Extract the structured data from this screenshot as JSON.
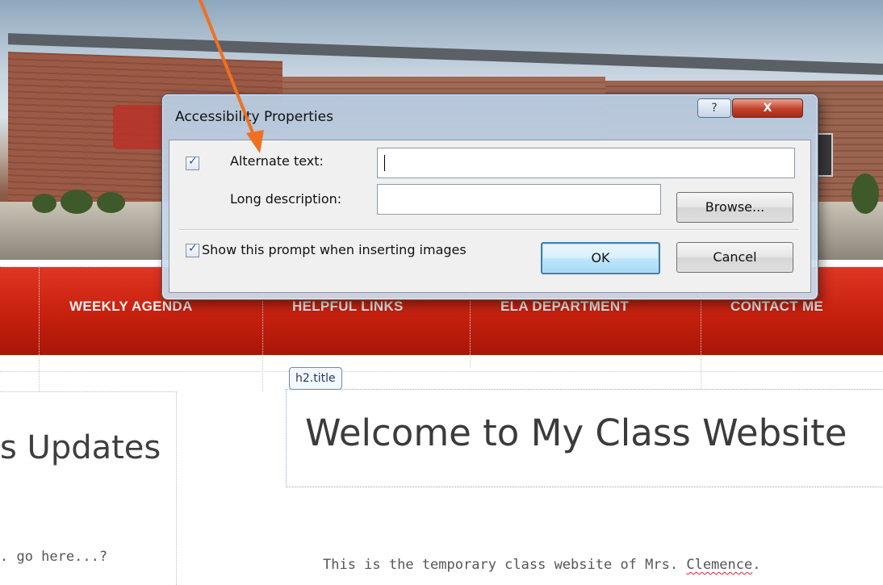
{
  "navigation": {
    "items": [
      {
        "label": "WEEKLY AGENDA"
      },
      {
        "label": "HELPFUL LINKS"
      },
      {
        "label": "ELA DEPARTMENT"
      },
      {
        "label": "CONTACT ME"
      }
    ]
  },
  "editor": {
    "element_tag": "h2.title"
  },
  "page": {
    "title": "Welcome to My Class Website",
    "sidebar_heading": "s Updates",
    "sidebar_text": ". go here...?",
    "intro_prefix": "This is the temporary class website of Mrs. ",
    "intro_name": "Clemence",
    "intro_suffix": "."
  },
  "dialog": {
    "title": "Accessibility Properties",
    "help_label": "?",
    "close_label": "X",
    "alt_text": {
      "label": "Alternate text:",
      "value": "",
      "checked": true
    },
    "long_description": {
      "label": "Long description:",
      "value": ""
    },
    "browse_label": "Browse...",
    "show_prompt": {
      "label": "Show this prompt when inserting images",
      "checked": true
    },
    "ok_label": "OK",
    "cancel_label": "Cancel"
  },
  "colors": {
    "nav_red": "#c9210f",
    "dialog_frame": "#b8cee4",
    "annotation_arrow": "#f07021",
    "focus_blue": "#3c7fb1"
  },
  "icons": {
    "checkbox_mark": "check-icon",
    "annotation": "arrow-icon"
  }
}
